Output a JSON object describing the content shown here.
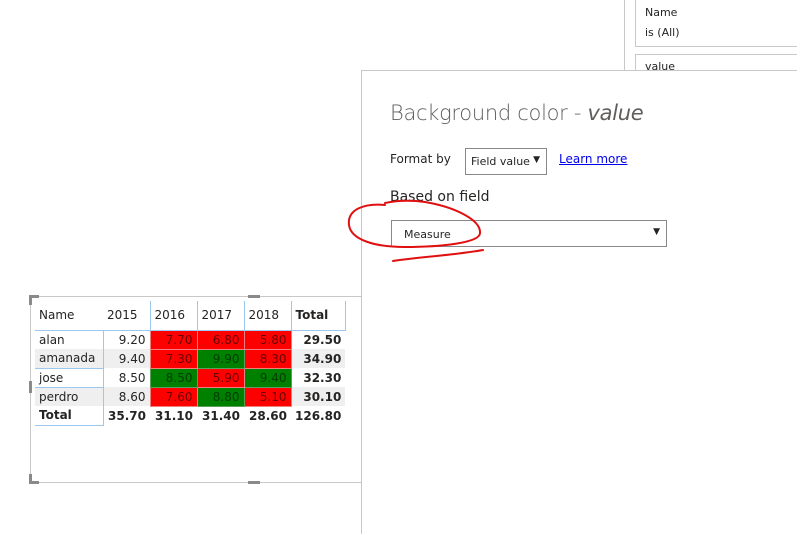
{
  "filters": [
    {
      "field": "Name",
      "condition": "is (All)"
    },
    {
      "field": "value"
    }
  ],
  "dialog": {
    "title": "Background color - ",
    "title_field": "value",
    "format_by_label": "Format by",
    "format_by_value": "Field value",
    "learn_more": "Learn more",
    "based_on_label": "Based on field",
    "based_on_value": "Measure",
    "dropdown_arrow": "▼"
  },
  "matrix": {
    "columns": [
      "Name",
      "2015",
      "2016",
      "2017",
      "2018",
      "Total"
    ],
    "rows": [
      {
        "name": "alan",
        "values": [
          "9.20",
          "7.70",
          "6.80",
          "5.80"
        ],
        "colors": [
          "",
          "red",
          "red",
          "red"
        ],
        "total": "29.50"
      },
      {
        "name": "amanada",
        "values": [
          "9.40",
          "7.30",
          "9.90",
          "8.30"
        ],
        "colors": [
          "",
          "red",
          "green",
          "red"
        ],
        "total": "34.90"
      },
      {
        "name": "jose",
        "values": [
          "8.50",
          "8.50",
          "5.90",
          "9.40"
        ],
        "colors": [
          "",
          "green",
          "red",
          "green"
        ],
        "total": "32.30"
      },
      {
        "name": "perdro",
        "values": [
          "8.60",
          "7.60",
          "8.80",
          "5.10"
        ],
        "colors": [
          "",
          "red",
          "green",
          "red"
        ],
        "total": "30.10"
      }
    ],
    "total_row": {
      "name": "Total",
      "values": [
        "35.70",
        "31.10",
        "31.40",
        "28.60"
      ],
      "total": "126.80"
    },
    "colors": {
      "red": "#ff0000",
      "green": "#008000",
      "border": "#9cc7ee"
    }
  },
  "annotation": {
    "color": "#e01010"
  }
}
